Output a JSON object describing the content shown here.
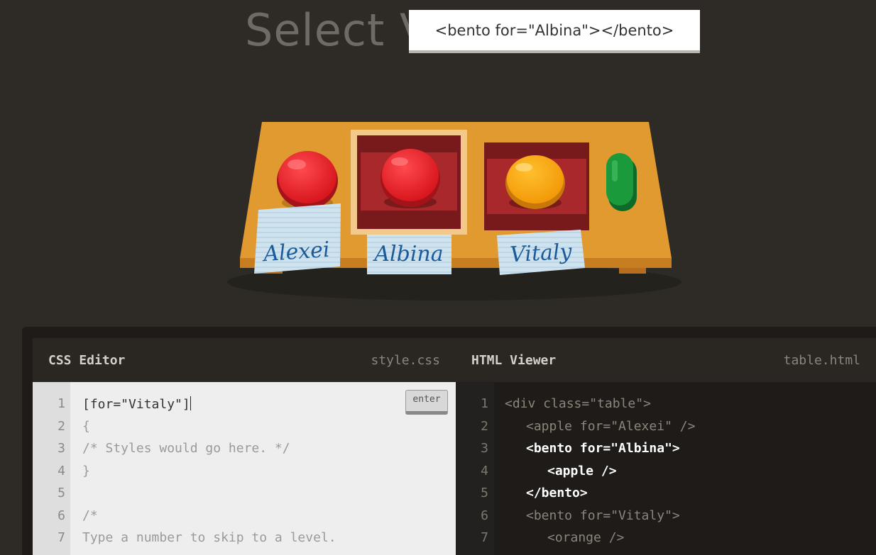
{
  "header": {
    "title": "Select V",
    "tooltip": "<bento for=\"Albina\"></bento>"
  },
  "table_scene": {
    "notes": [
      {
        "label": "Alexei"
      },
      {
        "label": "Albina"
      },
      {
        "label": "Vitaly"
      }
    ],
    "colors": {
      "table": "#e0992f",
      "apple": "#e31b23",
      "orange": "#f7a20f",
      "bento": "#a8282c",
      "pickle": "#1a9a3a"
    }
  },
  "css_editor": {
    "title": "CSS Editor",
    "filename": "style.css",
    "enter_label": "enter",
    "input_value": "[for=\"Vitaly\"]",
    "lines": [
      {
        "num": "1"
      },
      {
        "num": "2",
        "text": "{"
      },
      {
        "num": "3",
        "text": "/* Styles would go here. */"
      },
      {
        "num": "4",
        "text": "}"
      },
      {
        "num": "5",
        "text": ""
      },
      {
        "num": "6",
        "text": "/*"
      },
      {
        "num": "7",
        "text": "Type a number to skip to a level."
      }
    ]
  },
  "html_viewer": {
    "title": "HTML Viewer",
    "filename": "table.html",
    "lines": [
      {
        "num": "1",
        "text": "<div class=\"table\">"
      },
      {
        "num": "2",
        "text": "<apple for=\"Alexei\" />"
      },
      {
        "num": "3",
        "text": "<bento for=\"Albina\">"
      },
      {
        "num": "4",
        "text": "<apple />"
      },
      {
        "num": "5",
        "text": "</bento>"
      },
      {
        "num": "6",
        "text": "<bento for=\"Vitaly\">"
      },
      {
        "num": "7",
        "text": "<orange />"
      }
    ]
  }
}
